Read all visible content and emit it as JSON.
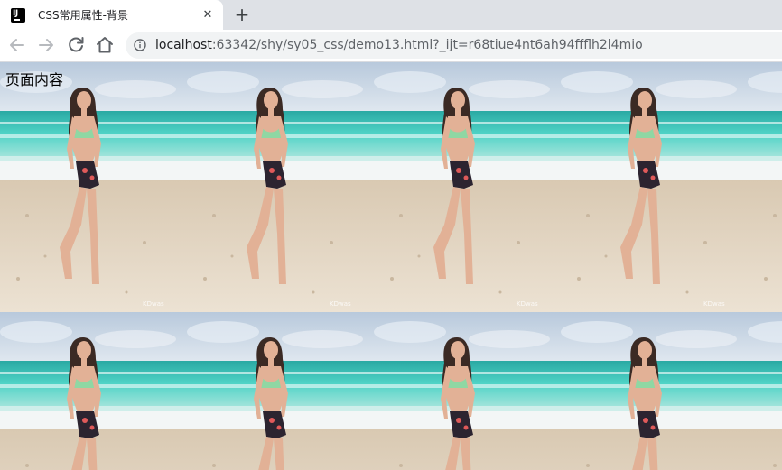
{
  "browser": {
    "tab": {
      "title": "CSS常用属性-背景",
      "favicon_label": "IJ",
      "close_glyph": "✕"
    },
    "new_tab_glyph": "+",
    "address": {
      "host": "localhost",
      "rest": ":63342/shy/sy05_css/demo13.html?_ijt=r68tiue4nt6ah94ffflh2l4mio"
    }
  },
  "page": {
    "text": "页面内容",
    "background": {
      "image": "beach-photo-tile",
      "repeat": "repeat",
      "visible_tiles": {
        "columns": 5,
        "rows": 2
      },
      "watermark": "KDwas"
    }
  },
  "colors": {
    "tabstrip": "#dee1e6",
    "omnibox": "#f1f3f4",
    "sky": "#c9d7e6",
    "sea": "#3fc9bd",
    "surf": "#ffffff",
    "sand": "#e3d5c0"
  }
}
